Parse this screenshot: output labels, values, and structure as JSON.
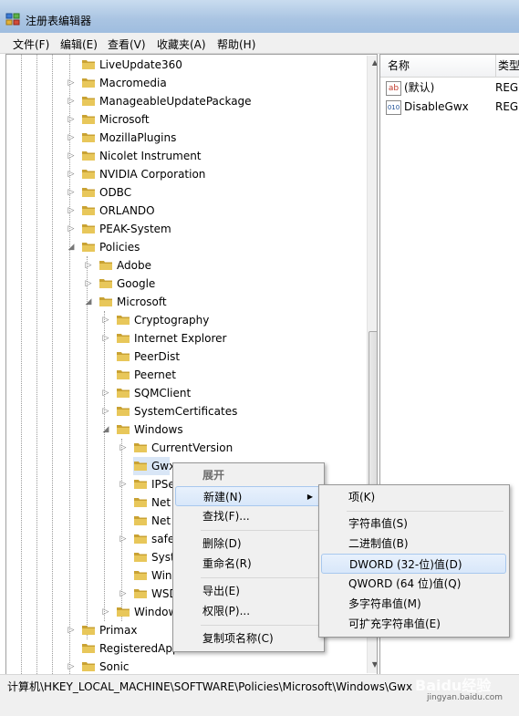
{
  "window": {
    "title": "注册表编辑器"
  },
  "menu": [
    "文件(F)",
    "编辑(E)",
    "查看(V)",
    "收藏夹(A)",
    "帮助(H)"
  ],
  "tree": [
    {
      "label": "LiveUpdate360",
      "expander": ""
    },
    {
      "label": "Macromedia",
      "expander": "▷"
    },
    {
      "label": "ManageableUpdatePackage",
      "expander": "▷"
    },
    {
      "label": "Microsoft",
      "expander": "▷"
    },
    {
      "label": "MozillaPlugins",
      "expander": "▷"
    },
    {
      "label": "Nicolet Instrument",
      "expander": "▷"
    },
    {
      "label": "NVIDIA Corporation",
      "expander": "▷"
    },
    {
      "label": "ODBC",
      "expander": "▷"
    },
    {
      "label": "ORLANDO",
      "expander": "▷"
    },
    {
      "label": "PEAK-System",
      "expander": "▷"
    },
    {
      "label": "Policies",
      "expander": "◢"
    },
    {
      "label": "Adobe",
      "expander": "▷"
    },
    {
      "label": "Google",
      "expander": "▷"
    },
    {
      "label": "Microsoft",
      "expander": "◢"
    },
    {
      "label": "Cryptography",
      "expander": "▷"
    },
    {
      "label": "Internet Explorer",
      "expander": "▷"
    },
    {
      "label": "PeerDist",
      "expander": ""
    },
    {
      "label": "Peernet",
      "expander": ""
    },
    {
      "label": "SQMClient",
      "expander": "▷"
    },
    {
      "label": "SystemCertificates",
      "expander": "▷"
    },
    {
      "label": "Windows",
      "expander": "◢"
    },
    {
      "label": "CurrentVersion",
      "expander": "▷"
    },
    {
      "label": "Gwx",
      "expander": ""
    },
    {
      "label": "IPSe",
      "expander": "▷"
    },
    {
      "label": "Net",
      "expander": ""
    },
    {
      "label": "Net",
      "expander": ""
    },
    {
      "label": "safe",
      "expander": "▷"
    },
    {
      "label": "Syst",
      "expander": ""
    },
    {
      "label": "Win",
      "expander": ""
    },
    {
      "label": "WSD",
      "expander": "▷"
    },
    {
      "label": "Window",
      "expander": "▷"
    },
    {
      "label": "Primax",
      "expander": "▷"
    },
    {
      "label": "RegisteredApplications",
      "expander": ""
    },
    {
      "label": "Sonic",
      "expander": "▷"
    }
  ],
  "right_pane": {
    "columns": [
      "名称",
      "类型"
    ],
    "values": [
      {
        "icon": "ab",
        "name": "(默认)",
        "type": "REG"
      },
      {
        "icon": "010",
        "name": "DisableGwx",
        "type": "REG"
      }
    ]
  },
  "context_menu": {
    "items": [
      "展开",
      "新建(N)",
      "查找(F)...",
      "删除(D)",
      "重命名(R)",
      "导出(E)",
      "权限(P)...",
      "复制项名称(C)"
    ],
    "submenu_arrow": "▶"
  },
  "submenu": {
    "items": [
      "项(K)",
      "字符串值(S)",
      "二进制值(B)",
      "DWORD (32-位)值(D)",
      "QWORD (64 位)值(Q)",
      "多字符串值(M)",
      "可扩充字符串值(E)"
    ]
  },
  "status": "计算机\\HKEY_LOCAL_MACHINE\\SOFTWARE\\Policies\\Microsoft\\Windows\\Gwx",
  "watermark": {
    "text": "Baidu经验",
    "sub": "jingyan.baidu.com"
  },
  "colors": {
    "folder": "#e8c75a",
    "folder_dark": "#c9a233",
    "highlight": "#d8e7fa",
    "titlebar": "#a9c4e2"
  }
}
